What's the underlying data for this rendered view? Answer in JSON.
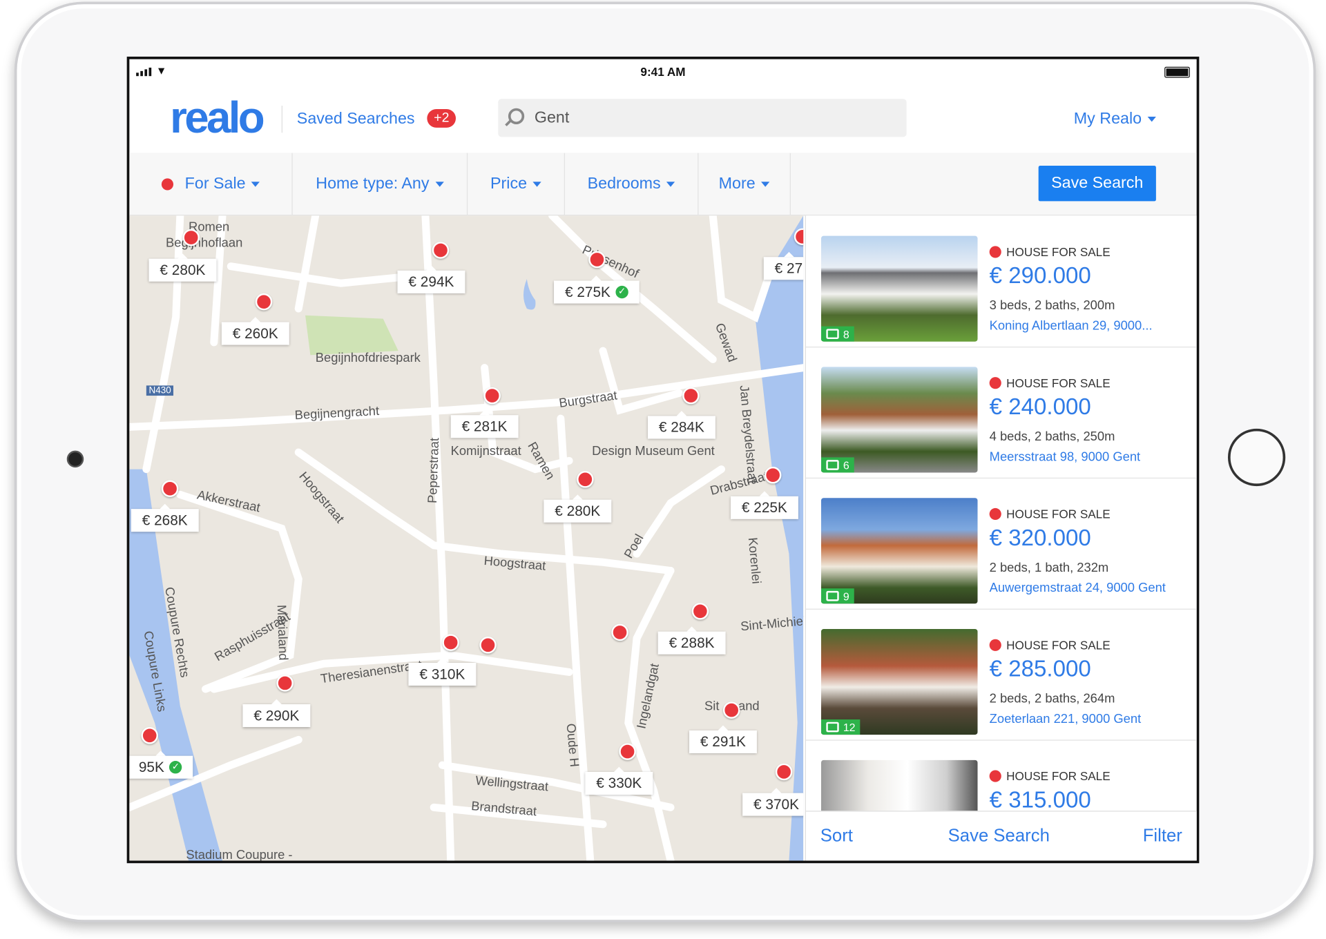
{
  "status": {
    "time": "9:41 AM"
  },
  "header": {
    "logo": "realo",
    "saved_searches": "Saved Searches",
    "saved_badge": "+2",
    "search_value": "Gent",
    "my_realo": "My Realo"
  },
  "filters": {
    "for_sale": "For Sale",
    "home_type": "Home type: Any",
    "price": "Price",
    "bedrooms": "Bedrooms",
    "more": "More",
    "save_search": "Save Search"
  },
  "map": {
    "markers": [
      {
        "price": "€ 280K"
      },
      {
        "price": "€ 260K"
      },
      {
        "price": "€ 294K"
      },
      {
        "price": "€ 275K",
        "verified": true
      },
      {
        "price": "€ 27"
      },
      {
        "price": "€ 281K"
      },
      {
        "price": "€ 284K"
      },
      {
        "price": "€ 268K"
      },
      {
        "price": "€ 280K"
      },
      {
        "price": "€ 225K"
      },
      {
        "price": "€ 288K"
      },
      {
        "price": "€ 310K"
      },
      {
        "price": "€ 290K"
      },
      {
        "price": "95K",
        "verified": true
      },
      {
        "price": "€ 291K"
      },
      {
        "price": "€ 330K"
      },
      {
        "price": "€ 370K"
      }
    ],
    "streets": [
      "Romen",
      "Begijnhoflaan",
      "Begijnhofdriespark",
      "Begijnengracht",
      "Burgstraat",
      "Komijnstraat",
      "Design Museum Gent",
      "Akkerstraat",
      "Hoogstraat",
      "Hoogstraat",
      "Peperstraat",
      "Prinsenhof",
      "Gewad",
      "Jan Breydelstraat",
      "Drabstraat",
      "Poel",
      "Ramen",
      "Rasphuisstraat",
      "Marialand",
      "Theresianenstraat",
      "Coupure Rechts",
      "Coupure Links",
      "Sint-Michiels",
      "Wellingstraat",
      "Brandstraat",
      "Ingelandgat",
      "Oude H",
      "Stadium Coupure -",
      "N430",
      "Korenlei",
      "Sit",
      "and"
    ],
    "colors": {
      "water": "#a8c4f0",
      "park": "#cfe3b5",
      "roads": "#ffffff",
      "land": "#ebe7e0"
    }
  },
  "listings": [
    {
      "type": "HOUSE FOR SALE",
      "price": "€ 290.000",
      "specs": "3 beds, 2 baths, 200m",
      "address": "Koning Albertlaan 29, 9000...",
      "photos": "8"
    },
    {
      "type": "HOUSE FOR SALE",
      "price": "€ 240.000",
      "specs": "4 beds, 2 baths, 250m",
      "address": "Meersstraat 98, 9000 Gent",
      "photos": "6"
    },
    {
      "type": "HOUSE FOR SALE",
      "price": "€ 320.000",
      "specs": "2 beds, 1 bath, 232m",
      "address": "Auwergemstraat 24, 9000 Gent",
      "photos": "9"
    },
    {
      "type": "HOUSE FOR SALE",
      "price": "€ 285.000",
      "specs": "2 beds, 2 baths, 264m",
      "address": "Zoeterlaan 221, 9000 Gent",
      "photos": "12"
    },
    {
      "type": "HOUSE FOR SALE",
      "price": "€ 315.000"
    }
  ],
  "bottom": {
    "sort": "Sort",
    "save_search": "Save Search",
    "filter": "Filter"
  },
  "colors": {
    "accent": "#2f7be6",
    "button": "#1a7ff0",
    "pin": "#e8363b",
    "photo_badge": "#2db24a"
  }
}
